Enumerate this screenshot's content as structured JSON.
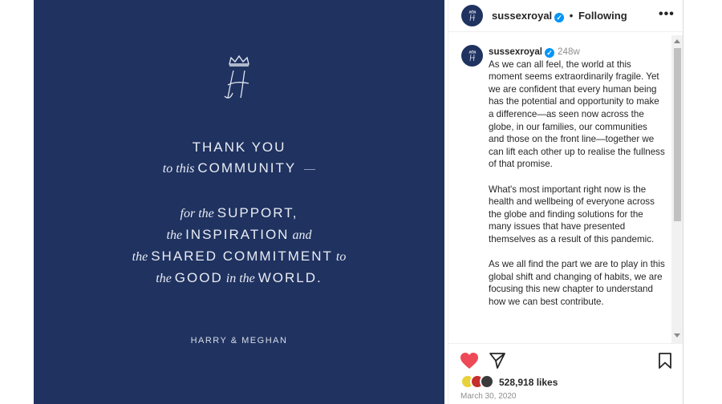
{
  "post_image": {
    "background_color": "#1f3260",
    "monogram_icon": "crowned-h-monogram-icon",
    "line1": "THANK YOU",
    "line2_a": "to this",
    "line2_b": "COMMUNITY",
    "line3_a": "for the",
    "line3_b": "SUPPORT,",
    "line4_a": "the",
    "line4_b": "INSPIRATION",
    "line4_c": "and",
    "line5_a": "the",
    "line5_b": "SHARED COMMITMENT",
    "line5_c": "to",
    "line6_a": "the",
    "line6_b": "GOOD",
    "line6_c": "in the",
    "line6_d": "WORLD.",
    "signature": "HARRY & MEGHAN"
  },
  "header": {
    "username": "sussexroyal",
    "separator": "•",
    "follow_status": "Following",
    "more_label": "•••"
  },
  "caption": {
    "username": "sussexroyal",
    "time_ago": "248w",
    "paragraph1": "As we can all feel, the world at this moment seems extraordinarily fragile. Yet we are confident that every human being has the potential and opportunity to make a difference—as seen now across the globe, in our families, our communities and those on the front line—together we can lift each other up to realise the fullness of that promise.",
    "paragraph2": "What's most important right now is the health and wellbeing of everyone across the globe and finding solutions for the many issues that have presented themselves as a result of this pandemic.",
    "paragraph3": "As we all find the part we are to play in this global shift and changing of habits, we are focusing this new chapter to understand how we can best contribute."
  },
  "actions": {
    "heart_color": "#ed4956",
    "likes": "528,918 likes",
    "date": "March 30, 2020"
  },
  "colors": {
    "verified_badge": "#0095f6"
  }
}
